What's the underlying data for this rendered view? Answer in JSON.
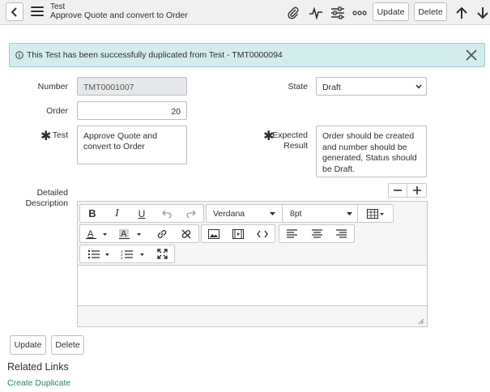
{
  "header": {
    "record_type": "Test",
    "record_title": "Approve Quote and convert to Order",
    "update_label": "Update",
    "delete_label": "Delete"
  },
  "alert": {
    "message": "This Test has been successfully duplicated from Test - TMT0000094"
  },
  "form": {
    "number_label": "Number",
    "number_value": "TMT0001007",
    "order_label": "Order",
    "order_value": "20",
    "test_label": "Test",
    "test_value": "Approve Quote and convert to Order",
    "state_label": "State",
    "state_value": "Draft",
    "expected_label_1": "Expected",
    "expected_label_2": "Result",
    "expected_value": "Order should be created and number should be generated, Status should be Draft.",
    "desc_label_1": "Detailed",
    "desc_label_2": "Description"
  },
  "editor": {
    "font_family": "Verdana",
    "font_size": "8pt"
  },
  "footer": {
    "update_label": "Update",
    "delete_label": "Delete",
    "related_links_title": "Related Links",
    "create_duplicate_link": "Create Duplicate"
  }
}
